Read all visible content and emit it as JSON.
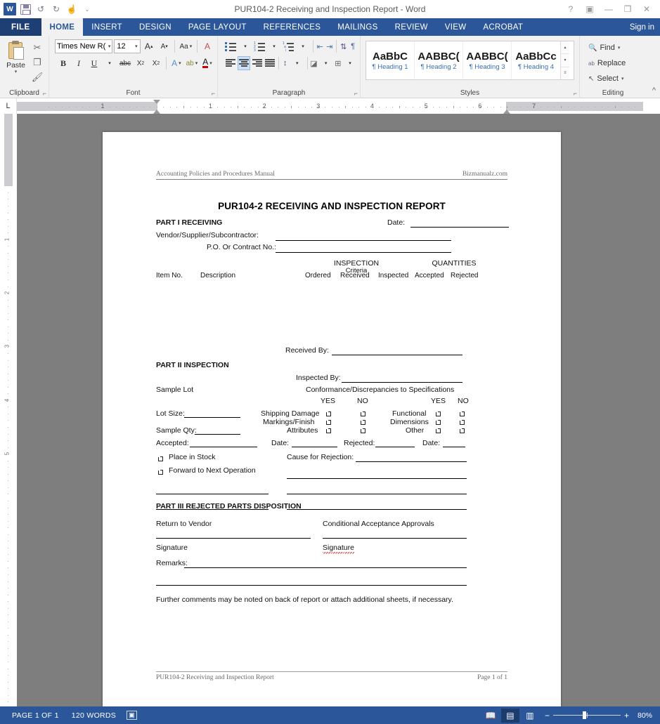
{
  "titlebar": {
    "document_title": "PUR104-2 Receiving and Inspection Report - Word",
    "quick_access": [
      {
        "name": "word-logo-icon",
        "label": "W"
      },
      {
        "name": "save-icon",
        "label": ""
      },
      {
        "name": "undo-icon",
        "label": "↺"
      },
      {
        "name": "redo-icon",
        "label": "↻"
      },
      {
        "name": "touch-mode-icon",
        "label": "☝"
      },
      {
        "name": "customize-qat-icon",
        "label": "⌄"
      }
    ],
    "window_controls": [
      {
        "name": "help-button",
        "label": "?"
      },
      {
        "name": "ribbon-display-options-button",
        "label": "▣"
      },
      {
        "name": "minimize-button",
        "label": "—"
      },
      {
        "name": "restore-button",
        "label": "❐"
      },
      {
        "name": "close-button",
        "label": "✕"
      }
    ],
    "signin_label": "Sign in"
  },
  "ribbon_tabs": {
    "file_label": "FILE",
    "tabs": [
      {
        "label": "HOME",
        "active": true
      },
      {
        "label": "INSERT",
        "active": false
      },
      {
        "label": "DESIGN",
        "active": false
      },
      {
        "label": "PAGE LAYOUT",
        "active": false
      },
      {
        "label": "REFERENCES",
        "active": false
      },
      {
        "label": "MAILINGS",
        "active": false
      },
      {
        "label": "REVIEW",
        "active": false
      },
      {
        "label": "VIEW",
        "active": false
      },
      {
        "label": "ACROBAT",
        "active": false
      }
    ]
  },
  "ribbon": {
    "clipboard": {
      "group_label": "Clipboard",
      "paste_label": "Paste",
      "paste_arrow": "▾",
      "cut_icon": "✂",
      "copy_icon": "❐",
      "format_painter_icon": "🖌"
    },
    "font": {
      "group_label": "Font",
      "font_name": "Times New R(",
      "font_size": "12",
      "grow_font": "A",
      "shrink_font": "A",
      "change_case": "Aa",
      "clear_formatting": "A",
      "bold": "B",
      "italic": "I",
      "underline": "U",
      "strikethrough": "abc",
      "subscript": "X",
      "superscript": "X",
      "text_effects": "A",
      "highlight": "ab",
      "font_color": "A"
    },
    "paragraph": {
      "group_label": "Paragraph",
      "bullets": "bullets-icon",
      "numbering": "numbering-icon",
      "multilevel": "multilevel-list-icon",
      "decrease_indent": "decrease-indent-icon",
      "increase_indent": "increase-indent-icon",
      "sort": "sort-icon",
      "show_marks": "¶",
      "align_left": "align-left-icon",
      "align_center": "align-center-icon",
      "align_right": "align-right-icon",
      "justify": "justify-icon",
      "line_spacing": "line-spacing-icon",
      "shading": "shading-icon",
      "borders": "borders-icon"
    },
    "styles": {
      "group_label": "Styles",
      "items": [
        {
          "preview": "AaBbC",
          "name": "Heading 1",
          "bold": true
        },
        {
          "preview": "AABBC(",
          "name": "Heading 2",
          "bold": true
        },
        {
          "preview": "AABBC(",
          "name": "Heading 3",
          "bold": true
        },
        {
          "preview": "AaBbCc",
          "name": "Heading 4",
          "bold": true
        }
      ],
      "pilcrow": "¶"
    },
    "editing": {
      "group_label": "Editing",
      "find_label": "Find",
      "replace_label": "Replace",
      "select_label": "Select",
      "find_icon": "🔍",
      "replace_icon": "ab",
      "select_icon": "↖",
      "find_arrow": "▾",
      "select_arrow": "▾"
    },
    "collapse_ribbon_icon": "^"
  },
  "ruler": {
    "tab_selector_label": "L",
    "horizontal_numbers": [
      "1",
      "1",
      "2",
      "3",
      "4",
      "5",
      "6",
      "7"
    ],
    "vertical_numbers": [
      "1",
      "2",
      "3",
      "4",
      "5"
    ]
  },
  "document": {
    "header_left": "Accounting Policies and Procedures Manual",
    "header_right": "Bizmanualz.com",
    "title": "PUR104-2 RECEIVING AND INSPECTION REPORT",
    "part1": {
      "heading": "PART I RECEIVING",
      "date_label": "Date:",
      "vendor_label": "Vendor/Supplier/Subcontractor:",
      "po_label": "P.O.  Or Contract No.:",
      "inspection_label": "INSPECTION",
      "criteria_label": "Criteria",
      "quantities_label": "QUANTITIES",
      "columns": [
        "Item No.",
        "Description",
        "Ordered",
        "Received",
        "Inspected",
        "Accepted",
        "Rejected"
      ],
      "received_by_label": "Received By:"
    },
    "part2": {
      "heading": "PART II INSPECTION",
      "inspected_by_label": "Inspected By:",
      "sample_lot_label": "Sample Lot",
      "conformance_label": "Conformance/Discrepancies to Specifications",
      "yes_label": "YES",
      "no_label": "NO",
      "lot_size_label": "Lot Size:",
      "sample_qty_label": "Sample Qty:",
      "left_criteria": [
        "Shipping Damage",
        "Markings/Finish",
        "Attributes"
      ],
      "right_criteria": [
        "Functional",
        "Dimensions",
        "Other"
      ],
      "accepted_label": "Accepted:",
      "date_label_1": "Date:",
      "rejected_label": "Rejected:",
      "date_label_2": "Date:",
      "place_in_stock_label": "Place in Stock",
      "forward_label": "Forward to Next Operation",
      "cause_label": "Cause for Rejection:"
    },
    "part3": {
      "heading": "PART III REJECTED PARTS DISPOSITION",
      "return_to_vendor_label": "Return to Vendor",
      "conditional_label": "Conditional Acceptance Approvals",
      "signature_left_label": "Signature",
      "signature_right_label": "Signature",
      "remarks_label": "Remarks:",
      "footnote": "Further comments may be noted on back of report or attach additional sheets, if necessary."
    },
    "footer_left": "PUR104-2 Receiving and Inspection Report",
    "footer_right": "Page 1 of 1"
  },
  "statusbar": {
    "page_label": "PAGE 1 OF 1",
    "words_label": "120 WORDS",
    "proofing_icon": "proofing-errors-icon",
    "views": [
      {
        "name": "read-mode-view-button",
        "icon": "📖",
        "active": false
      },
      {
        "name": "print-layout-view-button",
        "icon": "▤",
        "active": true
      },
      {
        "name": "web-layout-view-button",
        "icon": "▥",
        "active": false
      }
    ],
    "zoom_out": "−",
    "zoom_in": "+",
    "zoom_level": "80%"
  },
  "colors": {
    "word_blue": "#2b579a",
    "file_tab_blue": "#1e3f73",
    "ribbon_bg": "#f1f1f1",
    "workspace_gray": "#7e7e7e",
    "spell_error_red": "#d23a3a"
  }
}
